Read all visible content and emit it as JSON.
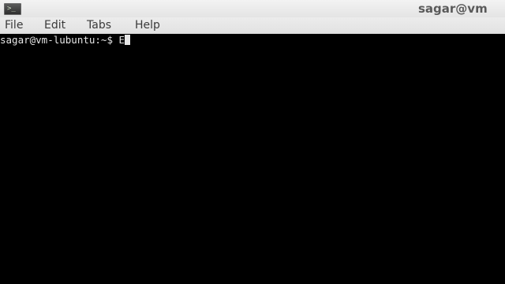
{
  "window": {
    "title": "sagar@vm",
    "icon": "terminal-icon"
  },
  "menubar": {
    "items": [
      {
        "label": "File"
      },
      {
        "label": "Edit"
      },
      {
        "label": "Tabs"
      },
      {
        "label": "Help"
      }
    ]
  },
  "terminal": {
    "prompt": "sagar@vm-lubuntu:~$ ",
    "input": "E",
    "background": "#000000",
    "foreground": "#e6e6e6"
  },
  "pointer": {
    "icon": "text-ibeam-cursor-icon",
    "color": "#e8e23a"
  }
}
